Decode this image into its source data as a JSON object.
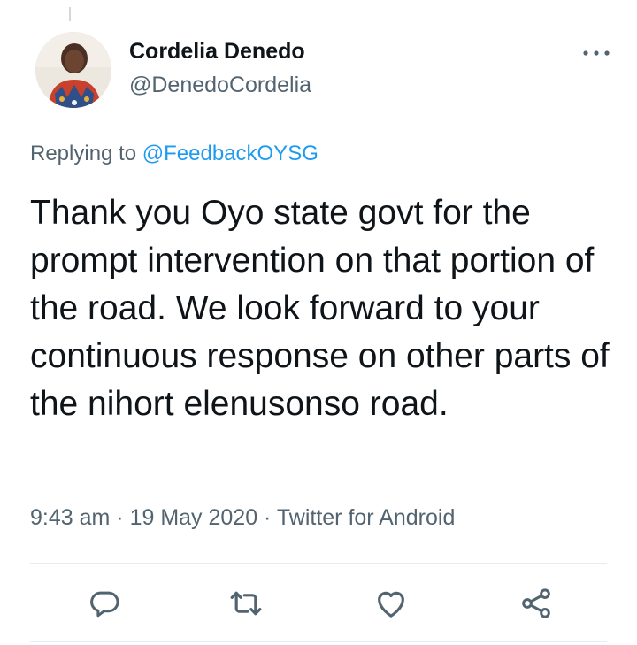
{
  "tweet": {
    "author": {
      "display_name": "Cordelia Denedo",
      "handle": "@DenedoCordelia"
    },
    "reply": {
      "prefix": "Replying to",
      "mention": "@FeedbackOYSG"
    },
    "text": "Thank you Oyo state govt for the prompt intervention on that portion of the road. We look forward to your continuous response on other parts of the nihort elenusonso road.",
    "meta": {
      "time": "9:43 am",
      "separator": " · ",
      "date": "19 May 2020",
      "source": "Twitter for Android"
    }
  },
  "icons": {
    "more": "more-dots-icon",
    "reply": "reply-bubble-icon",
    "retweet": "retweet-icon",
    "like": "heart-icon",
    "share": "share-icon"
  },
  "colors": {
    "text_primary": "#0f1419",
    "text_secondary": "#536471",
    "link": "#1d9bf0",
    "divider": "#e6ecf0"
  }
}
